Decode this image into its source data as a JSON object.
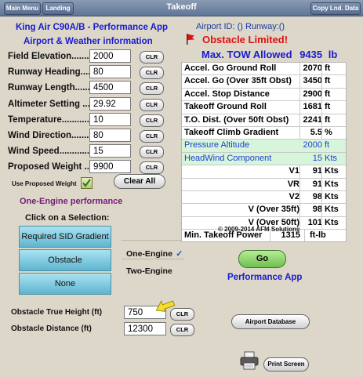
{
  "nav": {
    "main_menu": "Main Menu",
    "landing": "Landing",
    "title": "Takeoff",
    "copy_lnd": "Copy Lnd. Data"
  },
  "app_title": "King Air C90A/B - Performance App",
  "airport_header": "Airport & Weather information",
  "airport_id": "Airport ID: () Runway:()",
  "fields": [
    {
      "label": "Field Elevation.........",
      "value": "2000",
      "clr": "CLR"
    },
    {
      "label": "Runway Heading........",
      "value": "80",
      "clr": "CLR"
    },
    {
      "label": "Runway Length.........",
      "value": "4500",
      "clr": "CLR"
    },
    {
      "label": "Altimeter Setting ....",
      "value": "29.92",
      "clr": "CLR"
    },
    {
      "label": "Temperature...........",
      "value": "10",
      "clr": "CLR"
    },
    {
      "label": "Wind Direction.........",
      "value": "80",
      "clr": "CLR"
    },
    {
      "label": "Wind Speed..............",
      "value": "15",
      "clr": "CLR"
    },
    {
      "label": "Proposed Weight ...",
      "value": "9900",
      "clr": "CLR"
    }
  ],
  "use_proposed_weight": "Use Proposed Weight",
  "use_proposed_checked": true,
  "clear_all": "Clear All",
  "one_engine_perf": "One-Engine performance",
  "click_selection": "Click on a Selection:",
  "selections": [
    "Required SID Gradient",
    "Obstacle",
    "None"
  ],
  "engine_one": "One-Engine",
  "engine_one_check": "✓",
  "engine_two": "Two-Engine",
  "obstacle_height_label": "Obstacle True Height (ft)",
  "obstacle_height_value": "750",
  "obstacle_distance_label": "Obstacle Distance (ft)",
  "obstacle_distance_value": "12300",
  "obstacle_limited": "Obstacle Limited!",
  "max_tow_label": "Max. TOW Allowed",
  "max_tow_value": "9435",
  "max_tow_unit": "lb",
  "results": [
    {
      "label": "Accel. Go Ground Roll",
      "value": "2070",
      "unit": "ft"
    },
    {
      "label": "Accel. Go (Over 35ft Obst)",
      "value": "3450",
      "unit": "ft"
    },
    {
      "label": "Accel. Stop Distance",
      "value": "2900",
      "unit": "ft"
    },
    {
      "label": "Takeoff Ground Roll",
      "value": "1681",
      "unit": "ft"
    },
    {
      "label": "T.O. Dist. (Over 50ft Obst)",
      "value": "2241",
      "unit": "ft"
    },
    {
      "label": "Takeoff Climb Gradient",
      "value": "5.5",
      "unit": "%"
    },
    {
      "label": "Pressure Altitude",
      "value": "2000",
      "unit": "ft"
    },
    {
      "label": "HeadWind Component",
      "value": "15",
      "unit": "Kts"
    },
    {
      "label": "V1",
      "value": "91",
      "unit": "Kts"
    },
    {
      "label": "VR",
      "value": "91",
      "unit": "Kts"
    },
    {
      "label": "V2",
      "value": "98",
      "unit": "Kts"
    },
    {
      "label": "V (Over 35ft)",
      "value": "98",
      "unit": "Kts"
    },
    {
      "label": "V (Over 50ft)",
      "value": "101",
      "unit": "Kts"
    },
    {
      "label": "Min. Takeoff Power",
      "value": "1315",
      "unit": "ft-lb"
    }
  ],
  "copyright": "© 2009-2014 AFM Solutions",
  "go_label": "Go",
  "performance_app": "Performance App",
  "airport_database": "Airport Database",
  "print_screen": "Print Screen",
  "colors": {
    "accent_blue": "#1a1acd",
    "red": "#e01010",
    "go_green": "#7fcf62",
    "selection_blue": "#7fc7df",
    "green_row": "#d7f5da"
  }
}
